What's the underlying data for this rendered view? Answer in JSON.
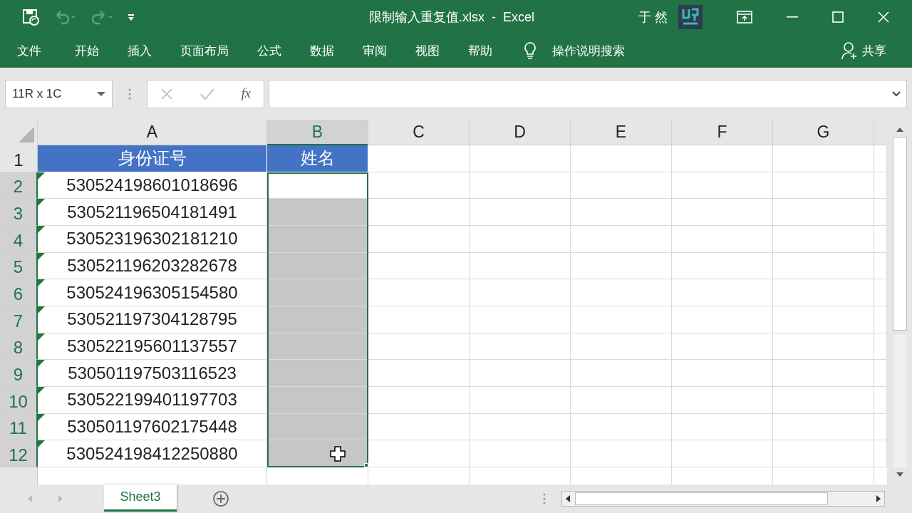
{
  "window": {
    "title": "限制输入重复值.xlsx  -  Excel",
    "user": "于 然"
  },
  "ribbon_tabs": [
    {
      "label": "文件"
    },
    {
      "label": "开始"
    },
    {
      "label": "插入"
    },
    {
      "label": "页面布局"
    },
    {
      "label": "公式"
    },
    {
      "label": "数据"
    },
    {
      "label": "审阅"
    },
    {
      "label": "视图"
    },
    {
      "label": "帮助"
    }
  ],
  "tell_me": {
    "label": "操作说明搜索"
  },
  "share": {
    "label": "共享"
  },
  "formula_bar": {
    "name_box": "11R x 1C",
    "function_button": "fx"
  },
  "columns": [
    {
      "label": "A",
      "selected": false
    },
    {
      "label": "B",
      "selected": true
    },
    {
      "label": "C",
      "selected": false
    },
    {
      "label": "D",
      "selected": false
    },
    {
      "label": "E",
      "selected": false
    },
    {
      "label": "F",
      "selected": false
    },
    {
      "label": "G",
      "selected": false
    }
  ],
  "rows": [
    {
      "number": "1",
      "selected": false,
      "kind": "header",
      "cells": [
        "身份证号",
        "姓名"
      ]
    },
    {
      "number": "2",
      "selected": true,
      "kind": "data",
      "flag": true,
      "active": true,
      "cells": [
        "530524198601018696",
        ""
      ]
    },
    {
      "number": "3",
      "selected": true,
      "kind": "data",
      "flag": true,
      "active": false,
      "cells": [
        "530521196504181491",
        ""
      ]
    },
    {
      "number": "4",
      "selected": true,
      "kind": "data",
      "flag": true,
      "active": false,
      "cells": [
        "530523196302181210",
        ""
      ]
    },
    {
      "number": "5",
      "selected": true,
      "kind": "data",
      "flag": true,
      "active": false,
      "cells": [
        "530521196203282678",
        ""
      ]
    },
    {
      "number": "6",
      "selected": true,
      "kind": "data",
      "flag": true,
      "active": false,
      "cells": [
        "530524196305154580",
        ""
      ]
    },
    {
      "number": "7",
      "selected": true,
      "kind": "data",
      "flag": true,
      "active": false,
      "cells": [
        "530521197304128795",
        ""
      ]
    },
    {
      "number": "8",
      "selected": true,
      "kind": "data",
      "flag": true,
      "active": false,
      "cells": [
        "530522195601137557",
        ""
      ]
    },
    {
      "number": "9",
      "selected": true,
      "kind": "data",
      "flag": true,
      "active": false,
      "cells": [
        "530501197503116523",
        ""
      ]
    },
    {
      "number": "10",
      "selected": true,
      "kind": "data",
      "flag": true,
      "active": false,
      "cells": [
        "530522199401197703",
        ""
      ]
    },
    {
      "number": "11",
      "selected": true,
      "kind": "data",
      "flag": true,
      "active": false,
      "cells": [
        "530501197602175448",
        ""
      ]
    },
    {
      "number": "12",
      "selected": true,
      "kind": "data",
      "flag": true,
      "active": false,
      "cells": [
        "530524198412250880",
        ""
      ]
    }
  ],
  "sheet_tabs": [
    {
      "label": "Sheet3",
      "selected": true
    }
  ]
}
